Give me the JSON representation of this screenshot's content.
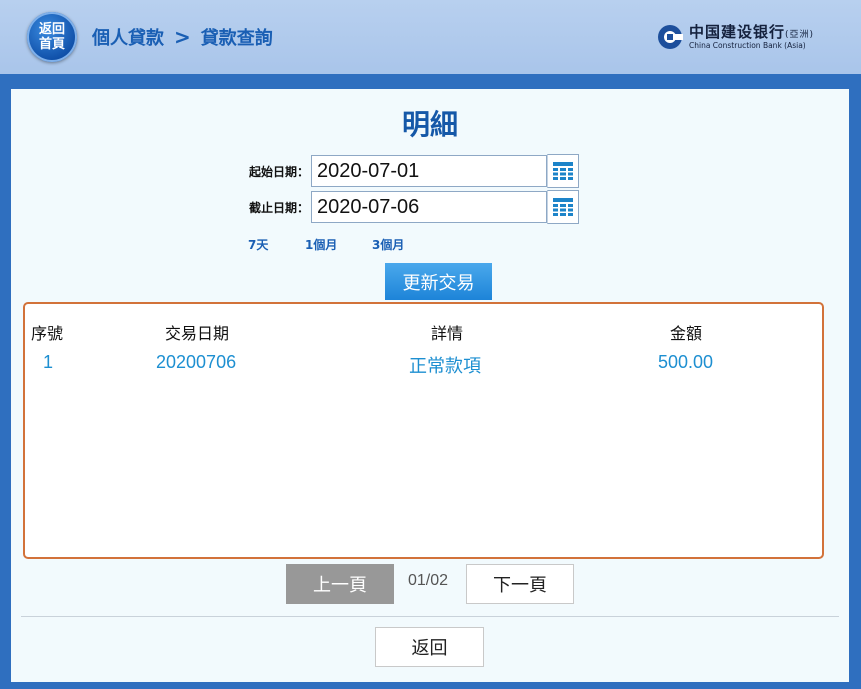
{
  "header": {
    "home_button": {
      "line1": "返回",
      "line2": "首頁"
    },
    "breadcrumb": [
      "個人貸款",
      "貸款查詢"
    ],
    "breadcrumb_separator": ">",
    "logo": {
      "cn": "中国建设银行",
      "cn_suffix": "(亞洲)",
      "en": "China Construction Bank (Asia)"
    }
  },
  "page": {
    "title": "明細",
    "start_date": {
      "label": "起始日期：",
      "value": "2020-07-01"
    },
    "end_date": {
      "label": "截止日期：",
      "value": "2020-07-06"
    },
    "quick_ranges": [
      "7天",
      "1個月",
      "3個月"
    ],
    "update_button": "更新交易"
  },
  "table": {
    "headers": [
      "序號",
      "交易日期",
      "詳情",
      "金額"
    ],
    "rows": [
      {
        "no": "1",
        "date": "20200706",
        "detail": "正常款項",
        "amount": "500.00"
      }
    ]
  },
  "pagination": {
    "prev": "上一頁",
    "current": "01/02",
    "next": "下一頁"
  },
  "back_button": "返回",
  "colors": {
    "accent": "#1558a8",
    "link": "#1d8fd1",
    "table_border": "#d2723a",
    "update_button": "#2a92e0"
  }
}
